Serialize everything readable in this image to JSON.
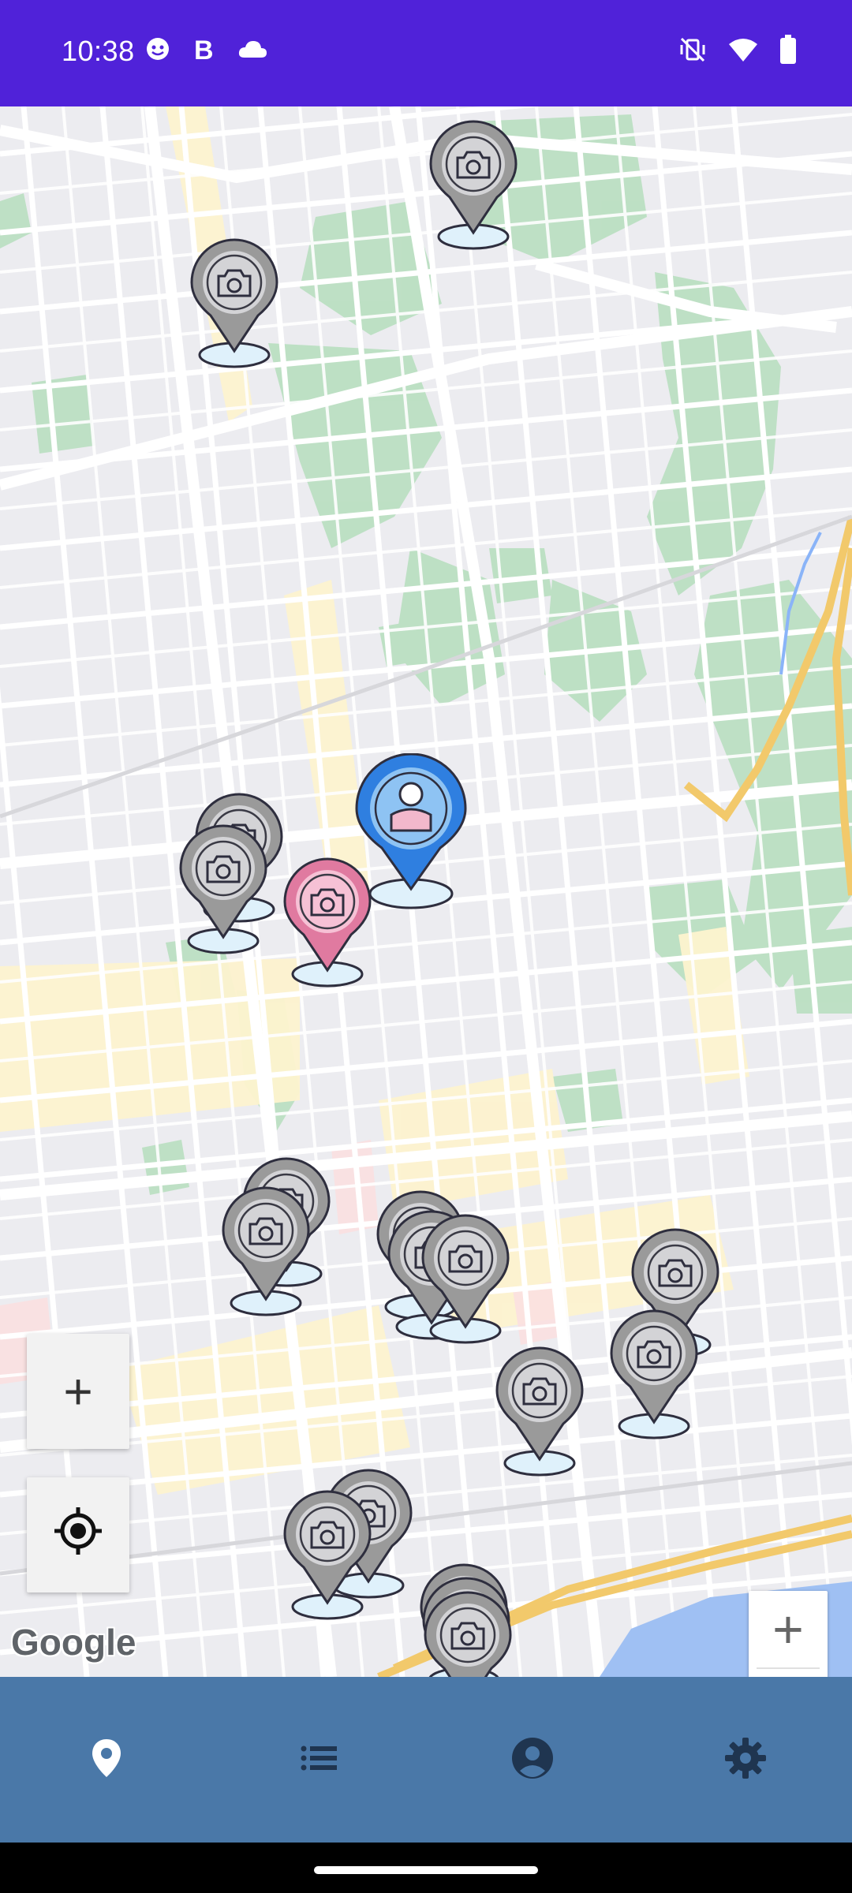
{
  "status_bar": {
    "time": "10:38",
    "left_icons": [
      "sync-face-icon",
      "b-app-icon",
      "cloud-icon"
    ],
    "right_icons": [
      "vibrate-off-icon",
      "wifi-icon",
      "battery-icon"
    ]
  },
  "map": {
    "attribution": "Google",
    "controls": {
      "zoom_in_fab": "+",
      "zoom_in": "+",
      "zoom_out": "−"
    }
  },
  "bottom_nav": {
    "items": [
      {
        "icon": "map-pin-icon",
        "active": true
      },
      {
        "icon": "list-icon",
        "active": false
      },
      {
        "icon": "account-icon",
        "active": false
      },
      {
        "icon": "settings-icon",
        "active": false
      }
    ]
  },
  "colors": {
    "status_bar": "#5022d9",
    "bottom_nav": "#4a78a8",
    "marker_gray": "#9a9a9a",
    "marker_pink": "#e07aa0",
    "marker_user": "#2f7fe0",
    "nav_icon": "#ffffff"
  }
}
